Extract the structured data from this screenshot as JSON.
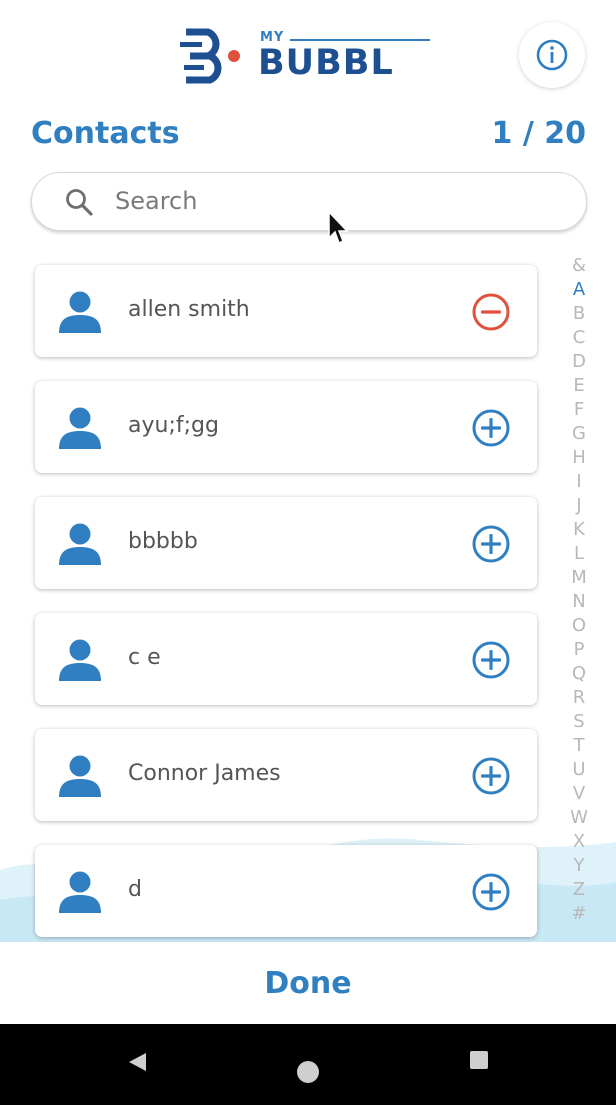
{
  "header": {
    "logo_small": "MY",
    "logo_big": "BUBBL",
    "info_icon": "info-circle-icon"
  },
  "page": {
    "title": "Contacts",
    "counter": "1 / 20"
  },
  "search": {
    "placeholder": "Search",
    "icon": "search-icon"
  },
  "contacts": [
    {
      "name": "allen smith",
      "action": "remove",
      "icon": "minus-circle-icon"
    },
    {
      "name": "ayu;f;gg",
      "action": "add",
      "icon": "plus-circle-icon"
    },
    {
      "name": "bbbbb",
      "action": "add",
      "icon": "plus-circle-icon"
    },
    {
      "name": "c e",
      "action": "add",
      "icon": "plus-circle-icon"
    },
    {
      "name": "Connor James",
      "action": "add",
      "icon": "plus-circle-icon"
    },
    {
      "name": "d",
      "action": "add",
      "icon": "plus-circle-icon"
    }
  ],
  "alphabet": {
    "letters": [
      "&",
      "A",
      "B",
      "C",
      "D",
      "E",
      "F",
      "G",
      "H",
      "I",
      "J",
      "K",
      "L",
      "M",
      "N",
      "O",
      "P",
      "Q",
      "R",
      "S",
      "T",
      "U",
      "V",
      "W",
      "X",
      "Y",
      "Z",
      "#"
    ],
    "active": "A"
  },
  "footer": {
    "done_label": "Done"
  },
  "colors": {
    "accent": "#2f7fc1",
    "remove": "#e0503a",
    "logo_dark": "#1d4f91"
  }
}
